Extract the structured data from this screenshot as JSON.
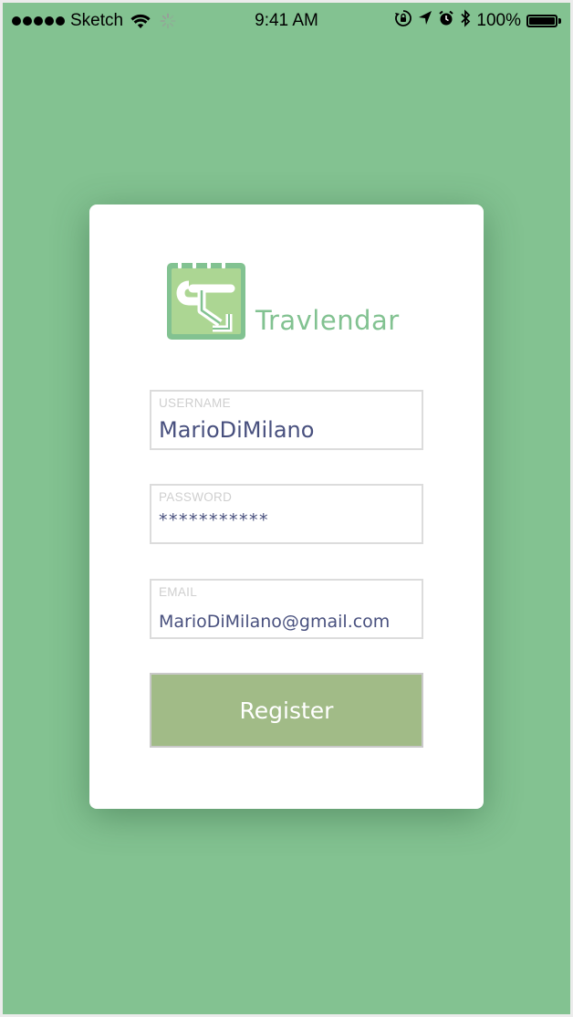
{
  "status_bar": {
    "carrier": "Sketch",
    "time": "9:41 AM",
    "battery_percent": "100%",
    "icons": [
      "signal-dots-icon",
      "wifi-icon",
      "loading-spinner-icon",
      "orientation-lock-icon",
      "location-arrow-icon",
      "alarm-icon",
      "bluetooth-icon",
      "battery-icon"
    ]
  },
  "logo": {
    "text": "Travlendar",
    "icon": "calendar-route-icon"
  },
  "form": {
    "username": {
      "label": "USERNAME",
      "value": "MarioDiMilano"
    },
    "password": {
      "label": "PASSWORD",
      "value": "***********"
    },
    "email": {
      "label": "EMAIL",
      "value": "MarioDiMilano@gmail.com"
    },
    "register_label": "Register"
  },
  "colors": {
    "background": "#83c291",
    "card": "#ffffff",
    "accent_green": "#82c291",
    "button": "#a1bb87",
    "input_text": "#48507e",
    "label_text": "#cfcfcf"
  }
}
